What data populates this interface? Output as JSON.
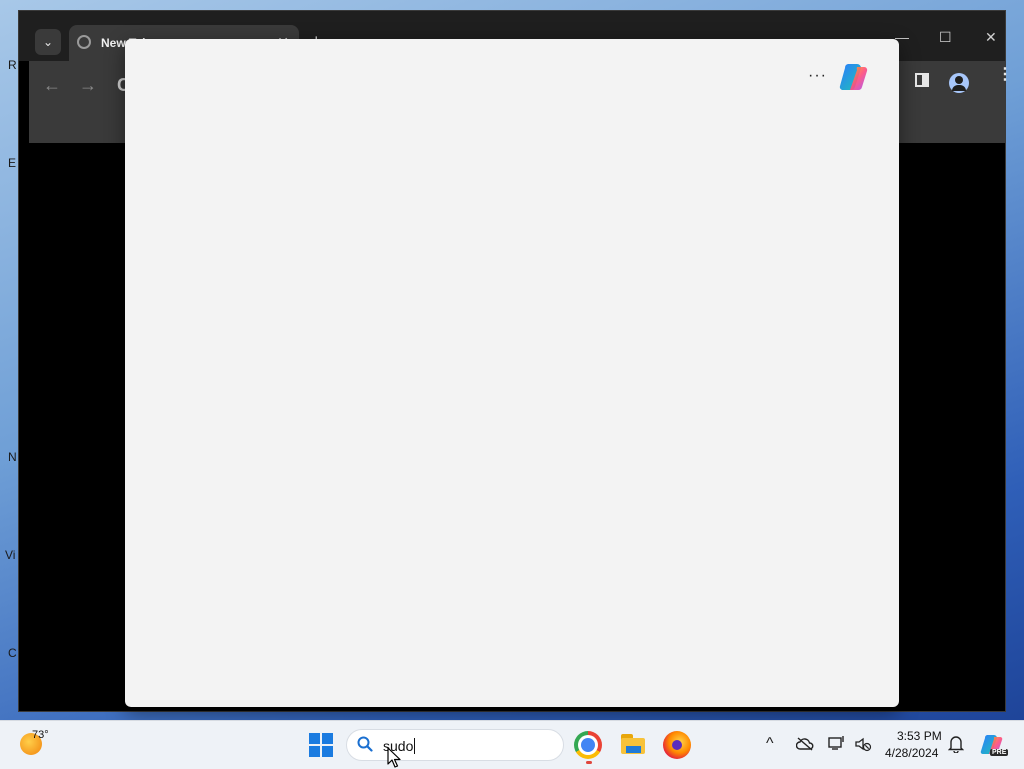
{
  "desktop": {
    "fragments": [
      "R",
      "E",
      "N",
      "Vi",
      "C"
    ]
  },
  "browser": {
    "tab_search_glyph": "⌄",
    "tab": {
      "title": "New Tab",
      "close_glyph": "✕"
    },
    "new_tab_glyph": "+",
    "window_controls": {
      "minimize": "—",
      "maximize": "☐",
      "close": "✕"
    },
    "back_glyph": "←",
    "forward_glyph": "→",
    "reload_glyph": "C",
    "kebab_glyph": "⋮",
    "icons": [
      "globe-icon",
      "side-panel-icon",
      "profile-icon",
      "kebab-icon"
    ]
  },
  "copilot": {
    "more_glyph": "···",
    "logo": "copilot-logo-icon"
  },
  "taskbar": {
    "weather_temp": "73°",
    "search_value": "sudo",
    "apps": [
      "chrome",
      "file-explorer",
      "firefox"
    ],
    "tray": {
      "chevron_glyph": "^",
      "clock_time": "3:53 PM",
      "clock_date": "4/28/2024",
      "badge": "PRE"
    }
  },
  "colors": {
    "chrome_titlebar": "#1f1f1f",
    "chrome_toolbar": "#3a3a3a",
    "copilot_bg": "#f3f3f3",
    "taskbar_bg": "#eef2f7",
    "windows_blue": "#1a7be0"
  }
}
